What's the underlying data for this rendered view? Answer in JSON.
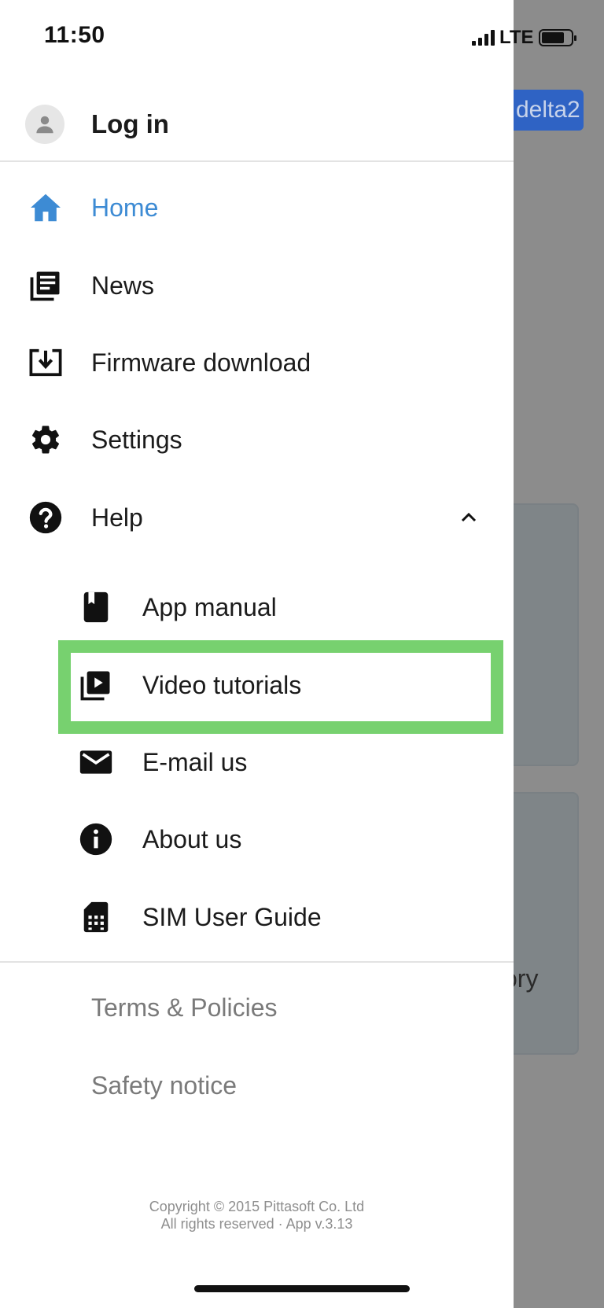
{
  "status_bar": {
    "time": "11:50",
    "network": "LTE"
  },
  "background": {
    "chip_label": "delta2",
    "card_text": "ory"
  },
  "drawer": {
    "login_label": "Log in",
    "menu": [
      {
        "label": "Home",
        "icon": "home-icon",
        "active": true
      },
      {
        "label": "News",
        "icon": "news-icon"
      },
      {
        "label": "Firmware download",
        "icon": "firmware-download-icon"
      },
      {
        "label": "Settings",
        "icon": "gear-icon"
      },
      {
        "label": "Help",
        "icon": "help-icon",
        "expanded": true
      }
    ],
    "help_submenu": [
      {
        "label": "App manual",
        "icon": "book-icon"
      },
      {
        "label": "Video tutorials",
        "icon": "video-library-icon",
        "highlighted": true
      },
      {
        "label": "E-mail us",
        "icon": "mail-icon"
      },
      {
        "label": "About us",
        "icon": "info-icon"
      },
      {
        "label": "SIM User Guide",
        "icon": "sim-card-icon"
      }
    ],
    "links": [
      {
        "label": "Terms & Policies"
      },
      {
        "label": "Safety notice"
      }
    ],
    "footer": {
      "line1": "Copyright © 2015 Pittasoft Co. Ltd",
      "line2": "All rights reserved · App v.3.13"
    }
  },
  "colors": {
    "active": "#3d8bd4",
    "highlight": "#77d16f",
    "overlay": "#8c8c8c",
    "chip": "#2f63c4"
  }
}
